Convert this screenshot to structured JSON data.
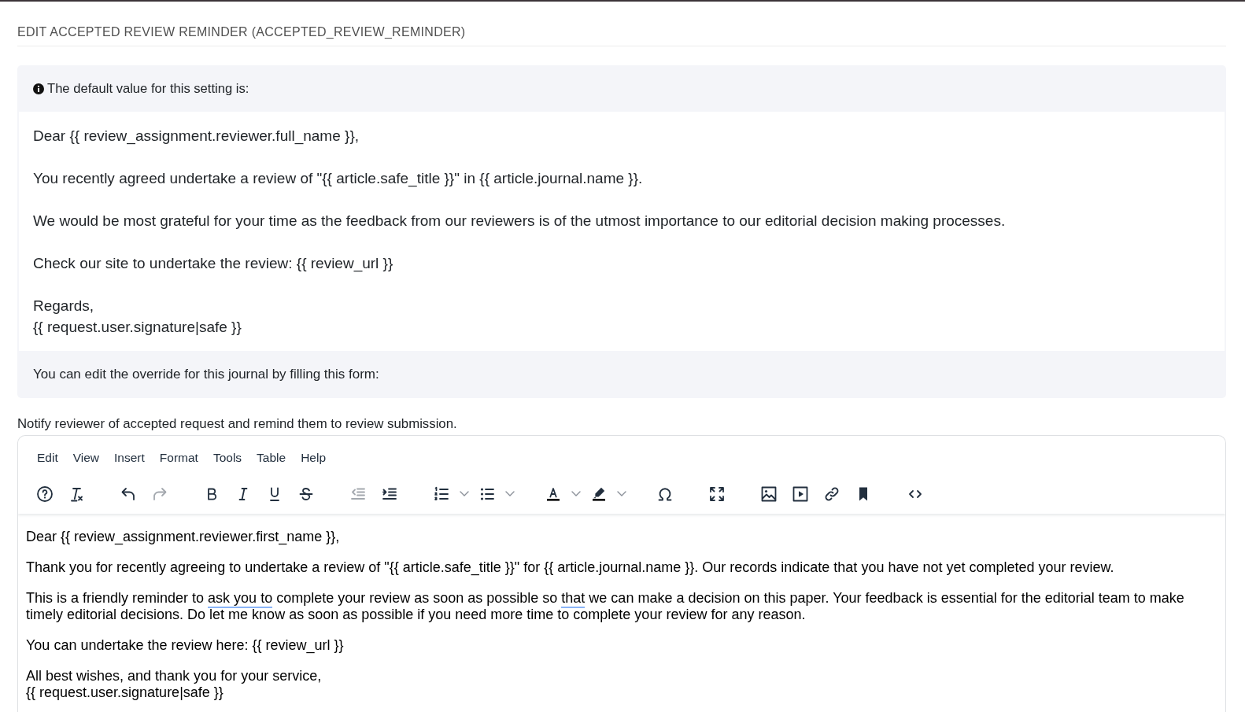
{
  "heading": {
    "title": "EDIT ACCEPTED REVIEW REMINDER (ACCEPTED_REVIEW_REMINDER)"
  },
  "default_notice": {
    "intro": "The default value for this setting is:",
    "paragraphs": [
      [
        "Dear {{ review_assignment.reviewer.full_name }},"
      ],
      [
        "You recently agreed undertake a review of \"{{ article.safe_title }}\" in {{ article.journal.name }}."
      ],
      [
        "We would be most grateful for your time as the feedback from our reviewers is of the utmost importance to our editorial decision making processes."
      ],
      [
        "Check our site to undertake the review: {{ review_url }}"
      ],
      [
        "Regards,",
        "{{ request.user.signature|safe }}"
      ]
    ],
    "footer": "You can edit the override for this journal by filling this form:"
  },
  "field": {
    "description": "Notify reviewer of accepted request and remind them to review submission.",
    "editor": {
      "menubar": [
        "Edit",
        "View",
        "Insert",
        "Format",
        "Tools",
        "Table",
        "Help"
      ],
      "toolbar": [
        {
          "buttons": [
            {
              "kind": "help",
              "disabled": false,
              "dropdown": false
            },
            {
              "kind": "clear_formatting",
              "disabled": false,
              "dropdown": false
            }
          ]
        },
        {
          "buttons": [
            {
              "kind": "undo",
              "disabled": false,
              "dropdown": false
            },
            {
              "kind": "redo",
              "disabled": true,
              "dropdown": false
            }
          ]
        },
        {
          "buttons": [
            {
              "kind": "bold",
              "disabled": false,
              "dropdown": false
            },
            {
              "kind": "italic",
              "disabled": false,
              "dropdown": false
            },
            {
              "kind": "underline",
              "disabled": false,
              "dropdown": false
            },
            {
              "kind": "strikethrough",
              "disabled": false,
              "dropdown": false
            }
          ]
        },
        {
          "buttons": [
            {
              "kind": "outdent",
              "disabled": true,
              "dropdown": false
            },
            {
              "kind": "indent",
              "disabled": false,
              "dropdown": false
            }
          ]
        },
        {
          "buttons": [
            {
              "kind": "numbered_list",
              "disabled": false,
              "dropdown": true
            },
            {
              "kind": "bullet_list",
              "disabled": false,
              "dropdown": true
            }
          ]
        },
        {
          "buttons": [
            {
              "kind": "text_color",
              "disabled": false,
              "dropdown": true
            },
            {
              "kind": "highlight",
              "disabled": false,
              "dropdown": true
            }
          ]
        },
        {
          "buttons": [
            {
              "kind": "special_character",
              "disabled": false,
              "dropdown": false
            }
          ]
        },
        {
          "buttons": [
            {
              "kind": "fullscreen",
              "disabled": false,
              "dropdown": false
            }
          ]
        },
        {
          "buttons": [
            {
              "kind": "image",
              "disabled": false,
              "dropdown": false
            },
            {
              "kind": "media",
              "disabled": false,
              "dropdown": false
            },
            {
              "kind": "link",
              "disabled": false,
              "dropdown": false
            },
            {
              "kind": "anchor",
              "disabled": false,
              "dropdown": false
            }
          ]
        },
        {
          "buttons": [
            {
              "kind": "source_code",
              "disabled": false,
              "dropdown": false
            }
          ]
        }
      ],
      "content": [
        {
          "lines": [
            [
              {
                "text": "Dear {{ review_assignment.reviewer.first_name }},",
                "flagged": false
              }
            ]
          ]
        },
        {
          "lines": [
            [
              {
                "text": "Thank you for recently agreeing to undertake a review of \"{{ article.safe_title }}\" for {{ article.journal.name }}. Our records indicate that you have not yet completed your review.",
                "flagged": false
              }
            ]
          ]
        },
        {
          "lines": [
            [
              {
                "text": "This is a friendly reminder to ",
                "flagged": false
              },
              {
                "text": "ask you to",
                "flagged": true
              },
              {
                "text": " complete your review as soon as possible so ",
                "flagged": false
              },
              {
                "text": "that",
                "flagged": true
              },
              {
                "text": " we can make a decision on this paper. Your feedback is essential for the editorial team to make timely editorial decisions. Do let me know as soon as possible if you need more time to complete your review for any reason.",
                "flagged": false
              }
            ]
          ]
        },
        {
          "lines": [
            [
              {
                "text": "You can undertake the review here: {{ review_url }}",
                "flagged": false
              }
            ]
          ]
        },
        {
          "lines": [
            [
              {
                "text": "All best wishes, and thank you for your service,",
                "flagged": false
              }
            ],
            [
              {
                "text": "{{ request.user.signature|safe }}",
                "flagged": false
              }
            ]
          ]
        }
      ]
    }
  }
}
